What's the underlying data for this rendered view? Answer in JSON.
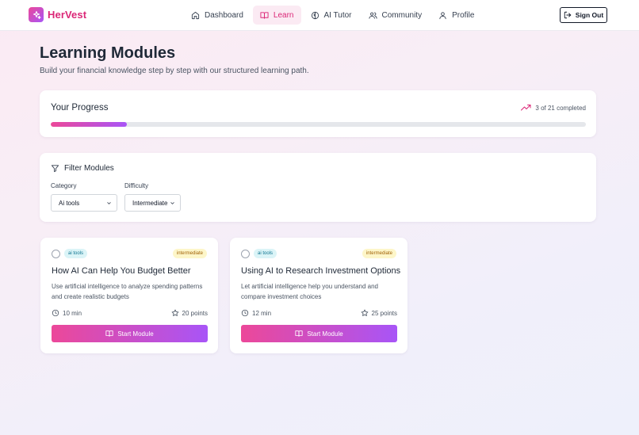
{
  "brand": {
    "name": "HerVest",
    "logo_icon": "sparkle-icon",
    "accent": "#ec4899",
    "accent2": "#a855f7"
  },
  "nav": {
    "items": [
      {
        "label": "Dashboard",
        "icon": "home-icon",
        "active": false
      },
      {
        "label": "Learn",
        "icon": "book-icon",
        "active": true
      },
      {
        "label": "AI Tutor",
        "icon": "brain-icon",
        "active": false
      },
      {
        "label": "Community",
        "icon": "users-icon",
        "active": false
      },
      {
        "label": "Profile",
        "icon": "user-icon",
        "active": false
      }
    ],
    "sign_out": "Sign Out"
  },
  "page": {
    "title": "Learning Modules",
    "subtitle": "Build your financial knowledge step by step with our structured learning path."
  },
  "progress": {
    "title": "Your Progress",
    "status": "3 of 21 completed",
    "completed": 3,
    "total": 21
  },
  "filter": {
    "title": "Filter Modules",
    "category_label": "Category",
    "category_value": "Ai tools",
    "difficulty_label": "Difficulty",
    "difficulty_value": "Intermediate"
  },
  "modules": [
    {
      "category": "ai tools",
      "level": "intermediate",
      "title": "How AI Can Help You Budget Better",
      "description": "Use artificial intelligence to analyze spending patterns and create realistic budgets",
      "duration": "10 min",
      "points": "20 points",
      "button": "Start Module"
    },
    {
      "category": "ai tools",
      "level": "intermediate",
      "title": "Using AI to Research Investment Options",
      "description": "Let artificial intelligence help you understand and compare investment choices",
      "duration": "12 min",
      "points": "25 points",
      "button": "Start Module"
    }
  ]
}
